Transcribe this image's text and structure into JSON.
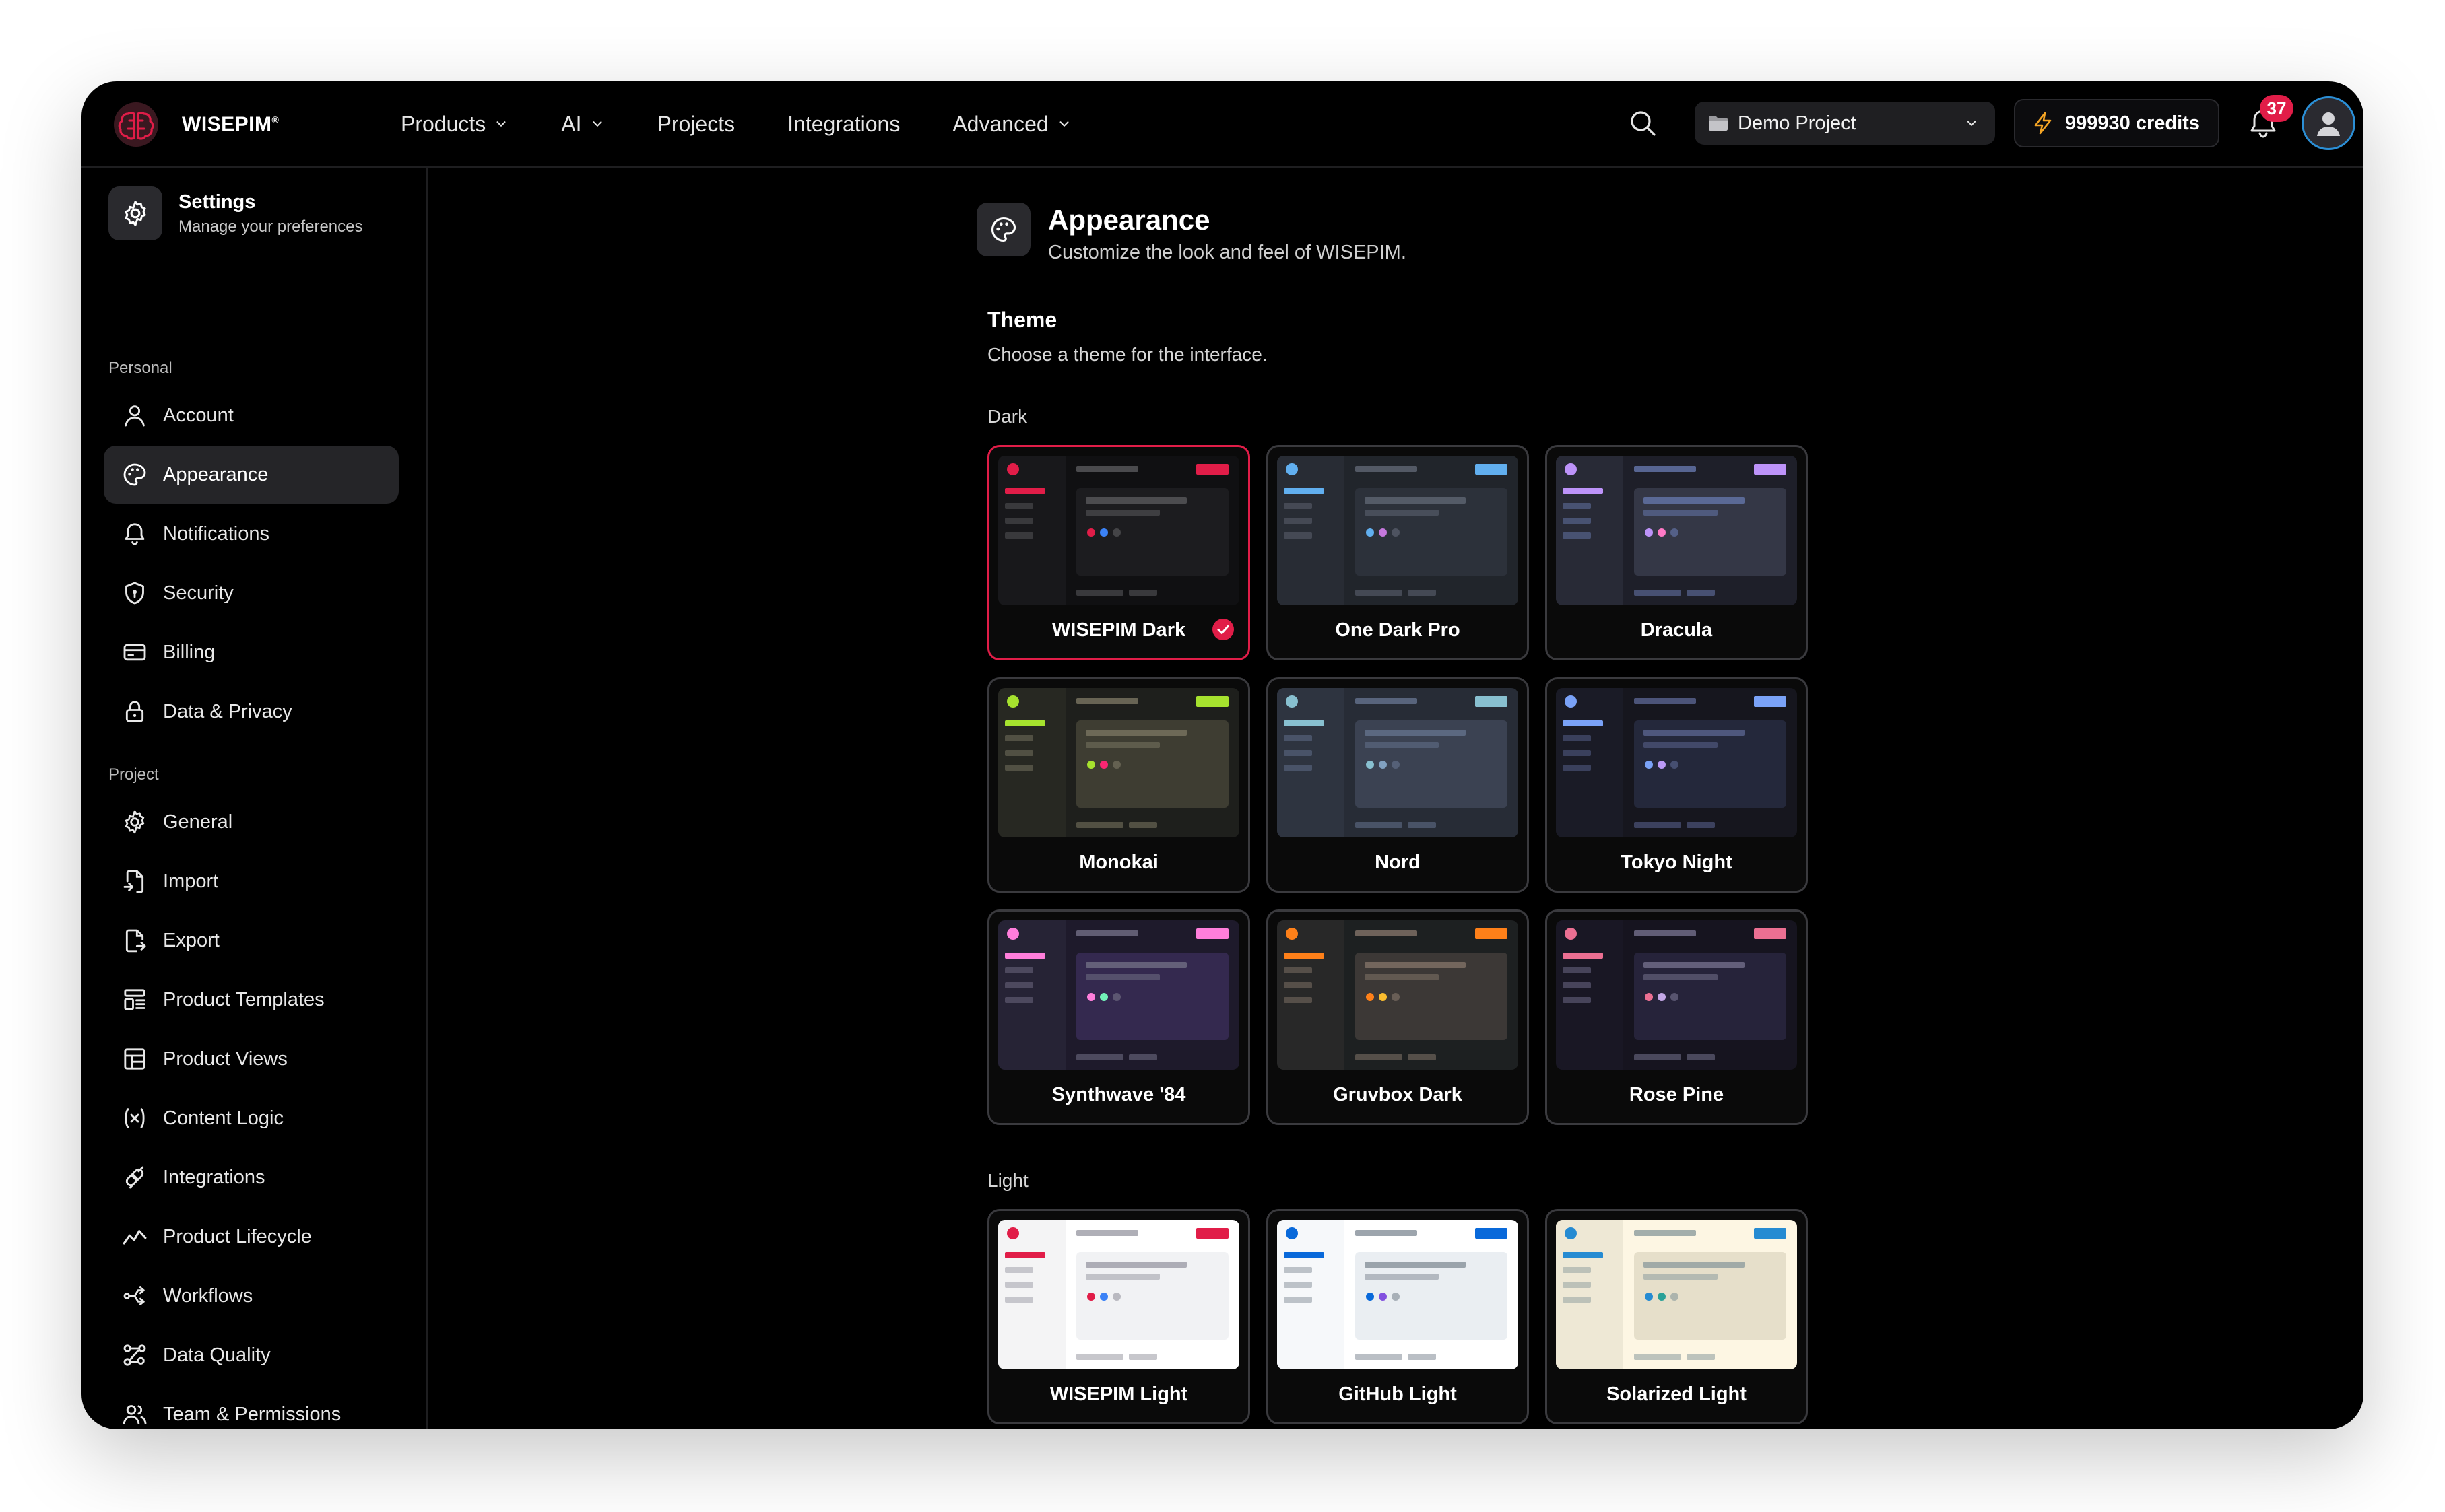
{
  "brand": {
    "name": "WISEPIM",
    "mark": "®"
  },
  "nav": [
    {
      "label": "Products",
      "dropdown": true
    },
    {
      "label": "AI",
      "dropdown": true
    },
    {
      "label": "Projects",
      "dropdown": false
    },
    {
      "label": "Integrations",
      "dropdown": false
    },
    {
      "label": "Advanced",
      "dropdown": true
    }
  ],
  "header": {
    "project": "Demo Project",
    "credits": "999930 credits",
    "notification_count": "37"
  },
  "sidebar": {
    "title": "Settings",
    "subtitle": "Manage your preferences",
    "personal_label": "Personal",
    "project_label": "Project",
    "personal": [
      {
        "label": "Account",
        "icon": "user-icon",
        "active": false
      },
      {
        "label": "Appearance",
        "icon": "palette-icon",
        "active": true
      },
      {
        "label": "Notifications",
        "icon": "bell-icon",
        "active": false
      },
      {
        "label": "Security",
        "icon": "shield-icon",
        "active": false
      },
      {
        "label": "Billing",
        "icon": "credit-card-icon",
        "active": false
      },
      {
        "label": "Data & Privacy",
        "icon": "lock-icon",
        "active": false
      }
    ],
    "project": [
      {
        "label": "General",
        "icon": "gear-icon"
      },
      {
        "label": "Import",
        "icon": "file-import-icon"
      },
      {
        "label": "Export",
        "icon": "file-export-icon"
      },
      {
        "label": "Product Templates",
        "icon": "template-icon"
      },
      {
        "label": "Product Views",
        "icon": "table-icon"
      },
      {
        "label": "Content Logic",
        "icon": "variable-icon"
      },
      {
        "label": "Integrations",
        "icon": "plug-icon"
      },
      {
        "label": "Product Lifecycle",
        "icon": "trend-icon"
      },
      {
        "label": "Workflows",
        "icon": "workflow-icon"
      },
      {
        "label": "Data Quality",
        "icon": "nodes-icon"
      },
      {
        "label": "Team & Permissions",
        "icon": "team-icon"
      }
    ]
  },
  "main": {
    "title": "Appearance",
    "subtitle": "Customize the look and feel of WISEPIM.",
    "theme_title": "Theme",
    "theme_subtitle": "Choose a theme for the interface.",
    "dark_label": "Dark",
    "light_label": "Light",
    "dark_themes": [
      {
        "name": "WISEPIM Dark",
        "selected": true,
        "colors": {
          "side": "#18181b",
          "main": "#101012",
          "panel": "#1c1c1f",
          "accent": "#e11d48",
          "dot2": "#3b82f6",
          "line": "#555558"
        }
      },
      {
        "name": "One Dark Pro",
        "selected": false,
        "colors": {
          "side": "#282c34",
          "main": "#21252b",
          "panel": "#2c313a",
          "accent": "#61afef",
          "dot2": "#c678dd",
          "line": "#5c6370"
        }
      },
      {
        "name": "Dracula",
        "selected": false,
        "colors": {
          "side": "#282a36",
          "main": "#1e1f29",
          "panel": "#343746",
          "accent": "#bd93f9",
          "dot2": "#ff79c6",
          "line": "#6272a4"
        }
      },
      {
        "name": "Monokai",
        "selected": false,
        "colors": {
          "side": "#272822",
          "main": "#1e1f1c",
          "panel": "#3e3d32",
          "accent": "#a6e22e",
          "dot2": "#f92672",
          "line": "#75715e"
        }
      },
      {
        "name": "Nord",
        "selected": false,
        "colors": {
          "side": "#2e3440",
          "main": "#272c36",
          "panel": "#3b4252",
          "accent": "#88c0d0",
          "dot2": "#81a1c1",
          "line": "#616e88"
        }
      },
      {
        "name": "Tokyo Night",
        "selected": false,
        "colors": {
          "side": "#1a1b26",
          "main": "#16161e",
          "panel": "#24283b",
          "accent": "#7aa2f7",
          "dot2": "#bb9af7",
          "line": "#565f89"
        }
      },
      {
        "name": "Synthwave '84",
        "selected": false,
        "colors": {
          "side": "#262335",
          "main": "#1e1a2b",
          "panel": "#34294f",
          "accent": "#ff7edb",
          "dot2": "#72f1b8",
          "line": "#6d6a80"
        }
      },
      {
        "name": "Gruvbox Dark",
        "selected": false,
        "colors": {
          "side": "#282828",
          "main": "#1d2021",
          "panel": "#3c3836",
          "accent": "#fe8019",
          "dot2": "#fabd2f",
          "line": "#7c6f64"
        }
      },
      {
        "name": "Rose Pine",
        "selected": false,
        "colors": {
          "side": "#191724",
          "main": "#16141f",
          "panel": "#26233a",
          "accent": "#eb6f92",
          "dot2": "#c4a7e7",
          "line": "#6e6a86"
        }
      }
    ],
    "light_themes": [
      {
        "name": "WISEPIM Light",
        "selected": false,
        "colors": {
          "side": "#f4f4f5",
          "main": "#ffffff",
          "panel": "#f1f2f4",
          "accent": "#e11d48",
          "dot2": "#3b82f6",
          "line": "#a1a1aa"
        }
      },
      {
        "name": "GitHub Light",
        "selected": false,
        "colors": {
          "side": "#f6f8fa",
          "main": "#ffffff",
          "panel": "#eaeef2",
          "accent": "#0969da",
          "dot2": "#8250df",
          "line": "#8c959f"
        }
      },
      {
        "name": "Solarized Light",
        "selected": false,
        "colors": {
          "side": "#eee8d5",
          "main": "#fdf6e3",
          "panel": "#e6dfca",
          "accent": "#268bd2",
          "dot2": "#2aa198",
          "line": "#93a1a1"
        }
      }
    ]
  }
}
